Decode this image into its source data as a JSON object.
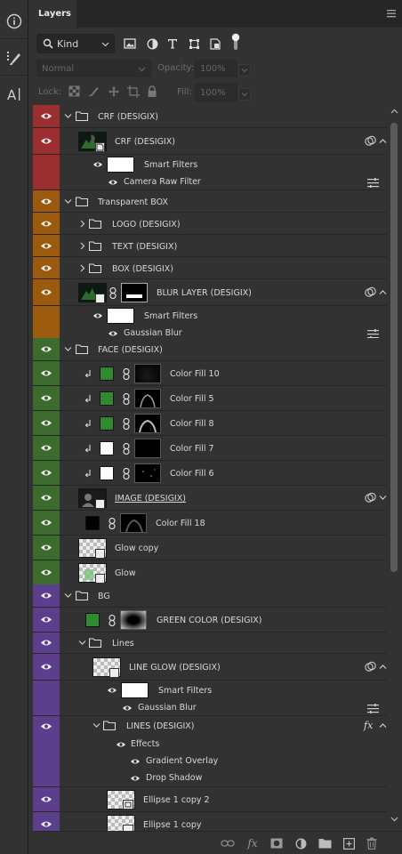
{
  "panel": {
    "tab": "Layers",
    "filter_kind": "Kind",
    "blend_mode": "Normal",
    "opacity_label": "Opacity:",
    "opacity_value": "100%",
    "lock_label": "Lock:",
    "fill_label": "Fill:",
    "fill_value": "100%"
  },
  "colors": {
    "red": "#9b2f2f",
    "orange": "#9b5a0e",
    "green": "#3b6b2d",
    "purple": "#5b3f8c",
    "accent_green": "#2f8a2f"
  },
  "layers": [
    {
      "name": "CRF (DESIGIX)"
    },
    {
      "name": "CRF (DESIGIX)"
    },
    {
      "name": "Smart Filters"
    },
    {
      "name": "Camera Raw Filter"
    },
    {
      "name": "Transparent BOX"
    },
    {
      "name": "LOGO (DESIGIX)"
    },
    {
      "name": "TEXT (DESIGIX)"
    },
    {
      "name": "BOX (DESIGIX)"
    },
    {
      "name": "BLUR LAYER (DESIGIX)"
    },
    {
      "name": "Smart Filters"
    },
    {
      "name": "Gaussian Blur"
    },
    {
      "name": "FACE (DESIGIX)"
    },
    {
      "name": "Color Fill 10"
    },
    {
      "name": "Color Fill 5"
    },
    {
      "name": "Color Fill 8"
    },
    {
      "name": "Color Fill 7"
    },
    {
      "name": "Color Fill 6"
    },
    {
      "name": "IMAGE (DESIGIX)"
    },
    {
      "name": "Color Fill 18"
    },
    {
      "name": "Glow copy"
    },
    {
      "name": "Glow"
    },
    {
      "name": "BG"
    },
    {
      "name": "GREEN COLOR (DESIGIX)"
    },
    {
      "name": "Lines"
    },
    {
      "name": "LINE GLOW (DESIGIX)"
    },
    {
      "name": "Smart Filters"
    },
    {
      "name": "Gaussian Blur"
    },
    {
      "name": "LINES (DESIGIX)"
    },
    {
      "name": "Effects"
    },
    {
      "name": "Gradient Overlay"
    },
    {
      "name": "Drop Shadow"
    },
    {
      "name": "Ellipse 1 copy 2"
    },
    {
      "name": "Ellipse 1 copy"
    }
  ]
}
